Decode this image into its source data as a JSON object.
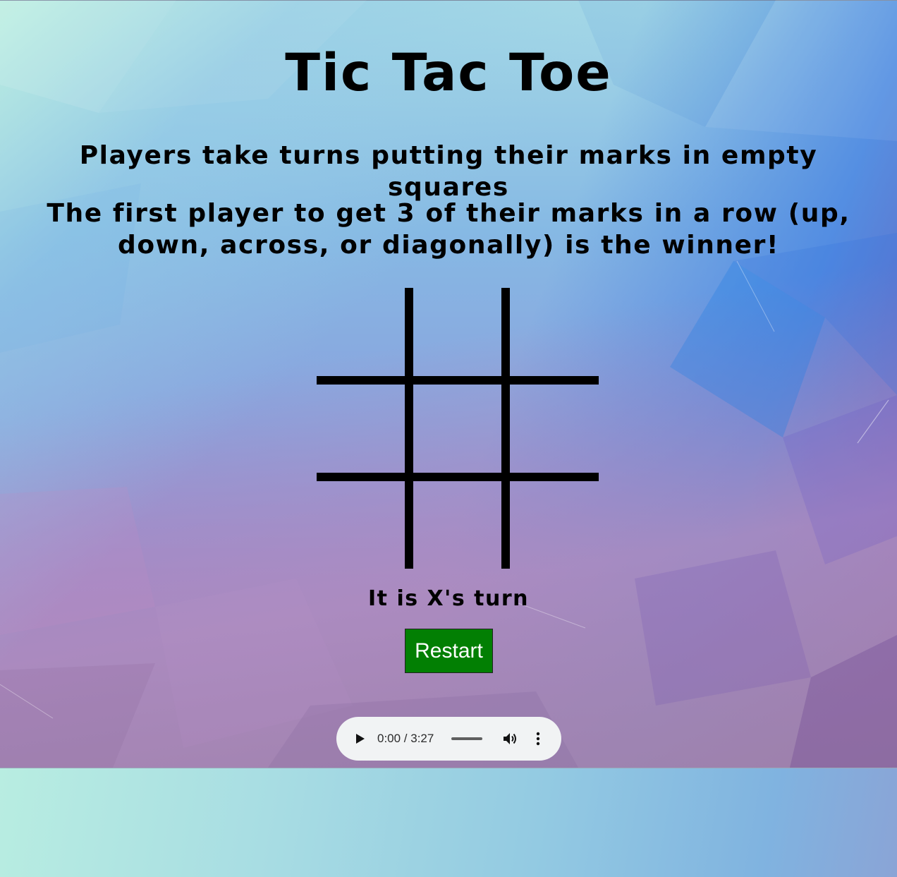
{
  "page": {
    "title": "Tic Tac Toe",
    "rules": [
      "Players take turns putting their marks in empty squares",
      "The first player to get 3 of their marks in a row (up, down, across, or diagonally) is the winner!"
    ],
    "status": "It is X's turn"
  },
  "board": {
    "cells": [
      "",
      "",
      "",
      "",
      "",
      "",
      "",
      "",
      ""
    ]
  },
  "controls": {
    "restart_label": "Restart"
  },
  "audio_player": {
    "time_display": "0:00 / 3:27",
    "progress": 0,
    "icons": {
      "play": "play-icon",
      "volume": "volume-icon",
      "more": "more-options-icon"
    }
  },
  "colors": {
    "restart_button": "#027f03",
    "grid_lines": "#000000",
    "audio_bar": "#f1f3f4"
  }
}
